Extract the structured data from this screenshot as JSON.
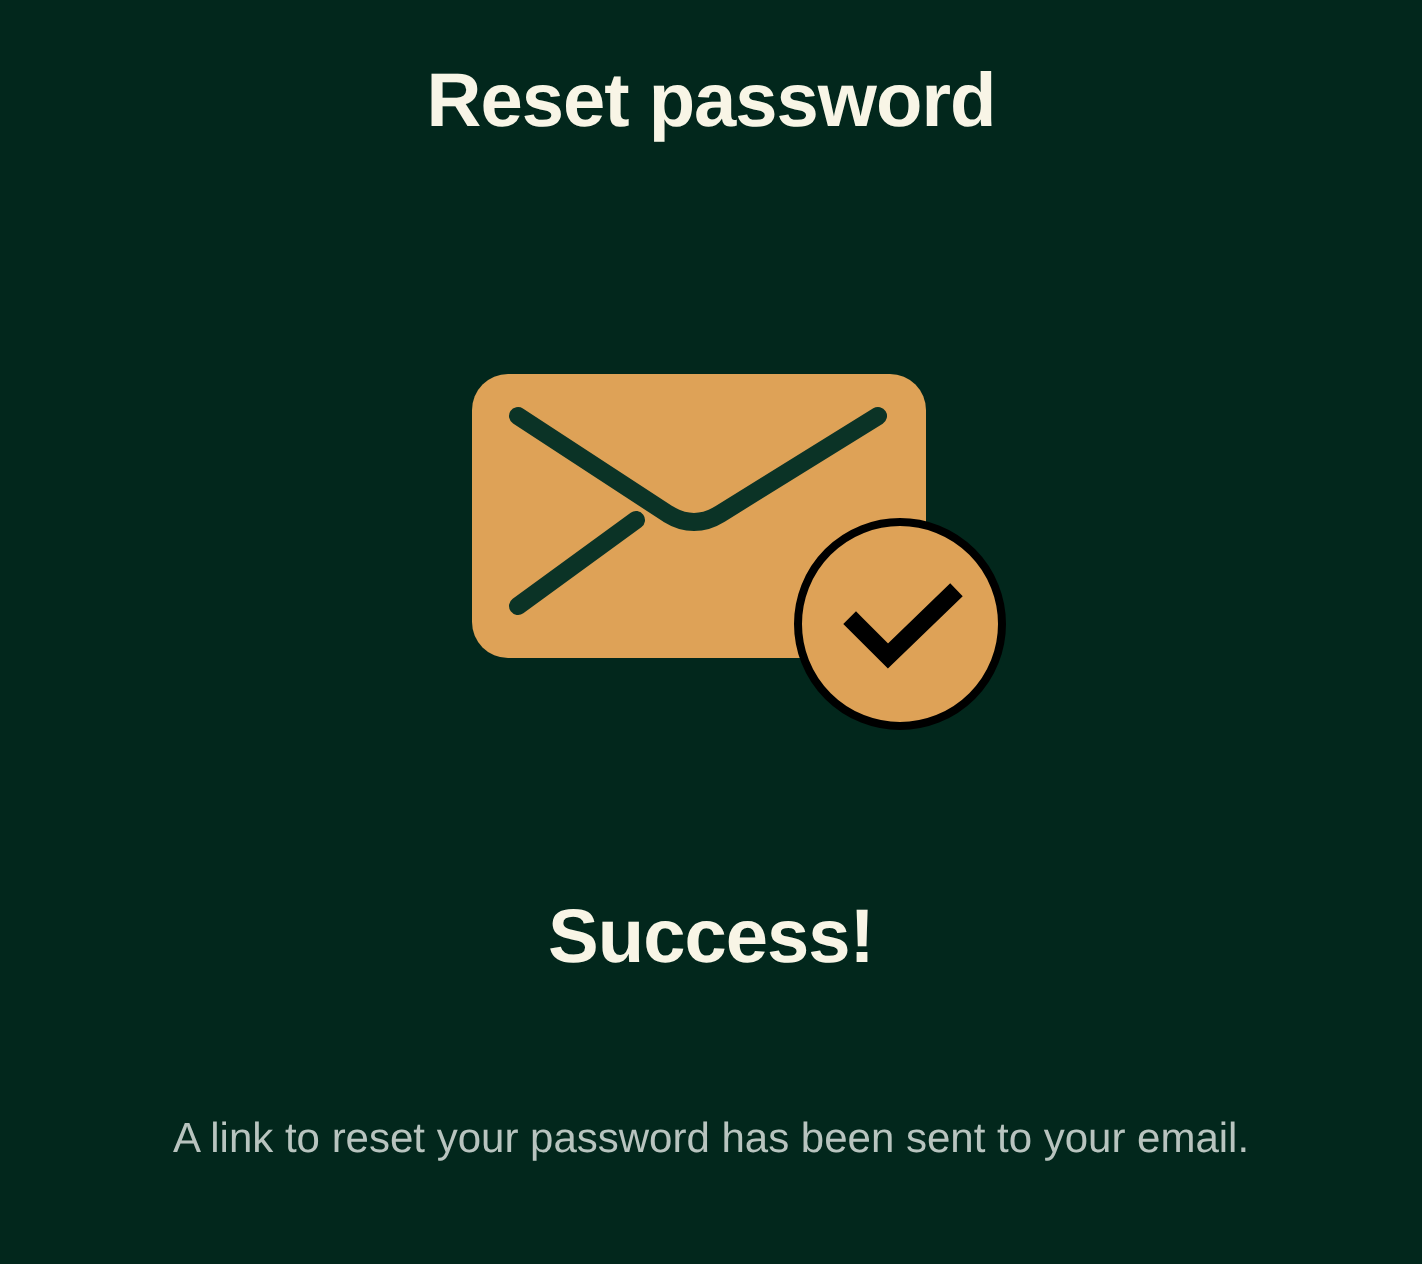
{
  "title": "Reset password",
  "result": {
    "heading": "Success!",
    "message": "A link to reset your password has been sent to your email."
  }
}
